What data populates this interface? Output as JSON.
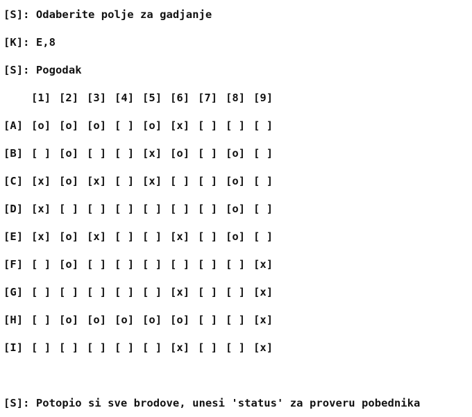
{
  "console": {
    "line1": "[S]: Odaberite polje za gadjanje",
    "line2": "[K]: E,8",
    "line3": "[S]: Pogodak",
    "final": "[S]: Potopio si sve brodove, unesi 'status' za proveru pobednika"
  },
  "board": {
    "headers": [
      "[1]",
      "[2]",
      "[3]",
      "[4]",
      "[5]",
      "[6]",
      "[7]",
      "[8]",
      "[9]"
    ],
    "rows": [
      {
        "label": "[A]",
        "cells": [
          "[o]",
          "[o]",
          "[o]",
          "[ ]",
          "[o]",
          "[x]",
          "[ ]",
          "[ ]",
          "[ ]"
        ]
      },
      {
        "label": "[B]",
        "cells": [
          "[ ]",
          "[o]",
          "[ ]",
          "[ ]",
          "[x]",
          "[o]",
          "[ ]",
          "[o]",
          "[ ]"
        ]
      },
      {
        "label": "[C]",
        "cells": [
          "[x]",
          "[o]",
          "[x]",
          "[ ]",
          "[x]",
          "[ ]",
          "[ ]",
          "[o]",
          "[ ]"
        ]
      },
      {
        "label": "[D]",
        "cells": [
          "[x]",
          "[ ]",
          "[ ]",
          "[ ]",
          "[ ]",
          "[ ]",
          "[ ]",
          "[o]",
          "[ ]"
        ]
      },
      {
        "label": "[E]",
        "cells": [
          "[x]",
          "[o]",
          "[x]",
          "[ ]",
          "[ ]",
          "[x]",
          "[ ]",
          "[o]",
          "[ ]"
        ]
      },
      {
        "label": "[F]",
        "cells": [
          "[ ]",
          "[o]",
          "[ ]",
          "[ ]",
          "[ ]",
          "[ ]",
          "[ ]",
          "[ ]",
          "[x]"
        ]
      },
      {
        "label": "[G]",
        "cells": [
          "[ ]",
          "[ ]",
          "[ ]",
          "[ ]",
          "[ ]",
          "[x]",
          "[ ]",
          "[ ]",
          "[x]"
        ]
      },
      {
        "label": "[H]",
        "cells": [
          "[ ]",
          "[o]",
          "[o]",
          "[o]",
          "[o]",
          "[o]",
          "[ ]",
          "[ ]",
          "[x]"
        ]
      },
      {
        "label": "[I]",
        "cells": [
          "[ ]",
          "[ ]",
          "[ ]",
          "[ ]",
          "[ ]",
          "[x]",
          "[ ]",
          "[ ]",
          "[x]"
        ]
      }
    ]
  }
}
